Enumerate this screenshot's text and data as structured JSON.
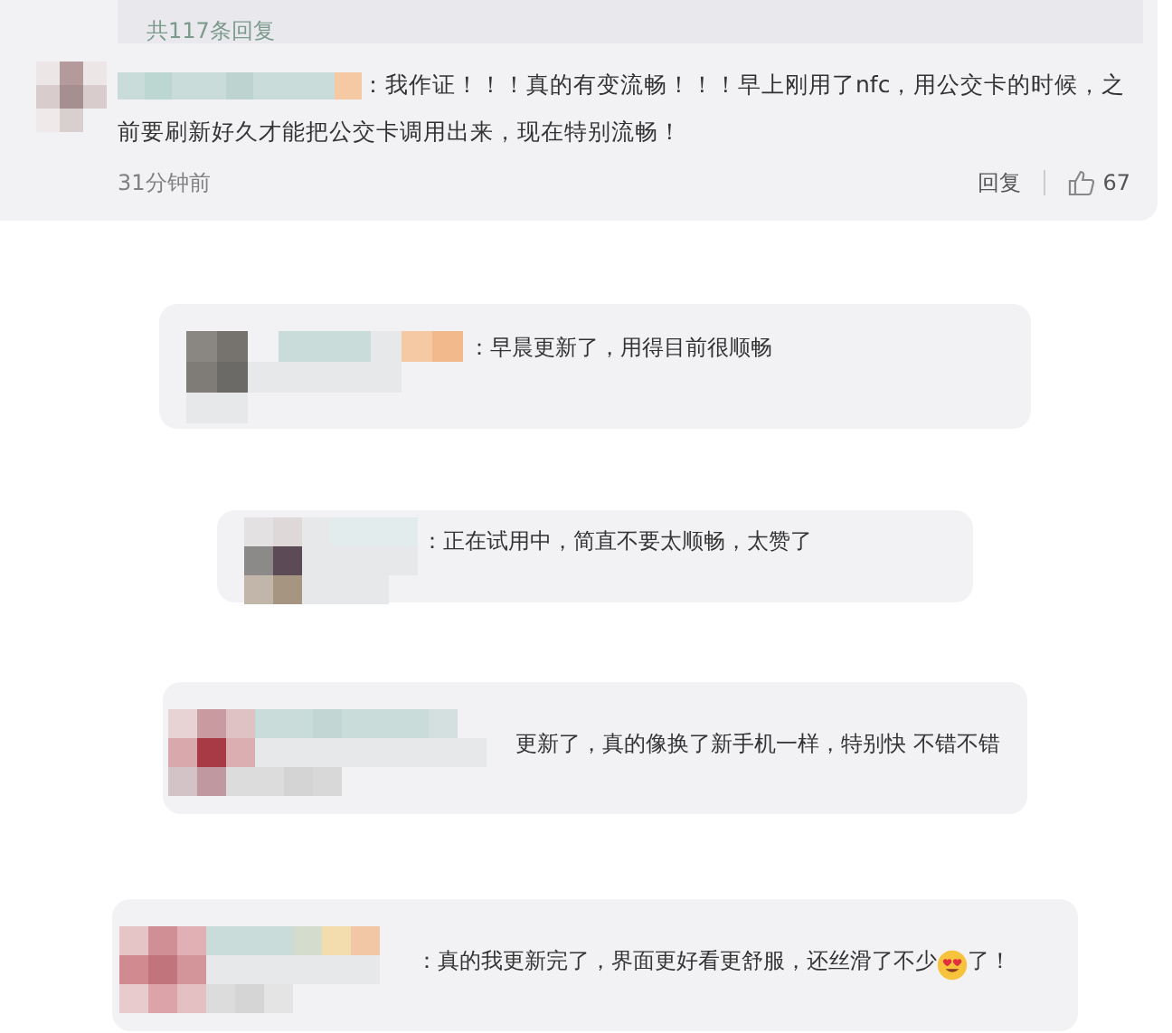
{
  "reply_strip": {
    "text": "共117条回复"
  },
  "main_comment": {
    "lines": [
      "：我作证！！！真的有变流畅！！！早上刚用了nfc，用公交卡的时候，之",
      "前要刷新好久才能把公交卡调用出来，现在特别流畅！"
    ],
    "time": "31分钟前",
    "reply": "回复",
    "likes": "67"
  },
  "comments": [
    {
      "text": "：早晨更新了，用得目前很顺畅"
    },
    {
      "text": "：正在试用中，简直不要太顺畅，太赞了"
    },
    {
      "text": "更新了，真的像换了新手机一样，特别快 不错不错"
    },
    {
      "text": "：真的我更新完了，界面更好看更舒服，还丝滑了不少",
      "text_after": "了！"
    }
  ]
}
